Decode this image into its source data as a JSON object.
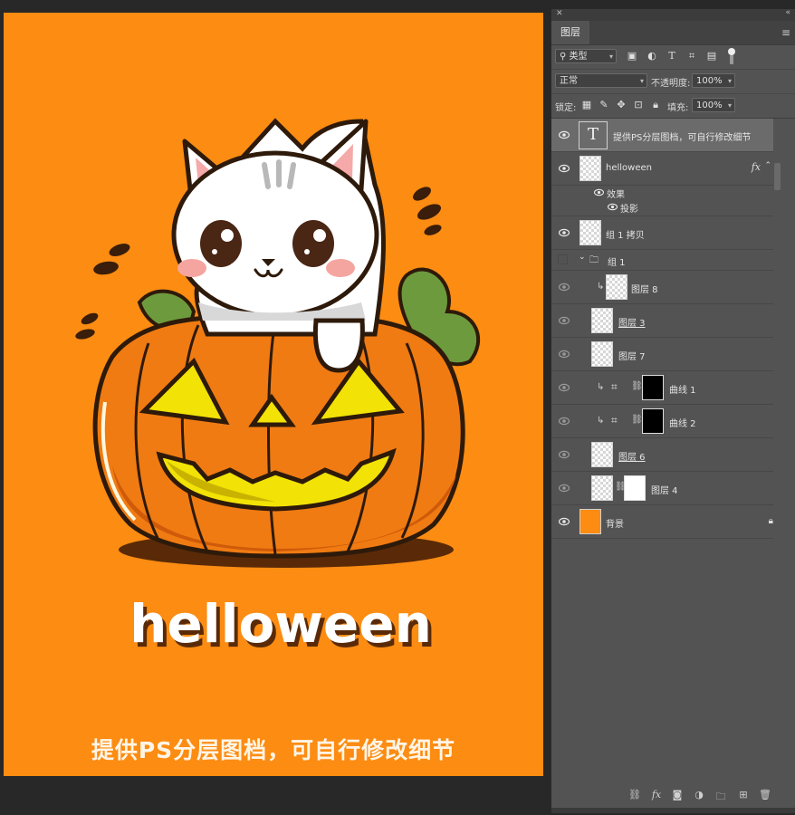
{
  "canvas": {
    "background_color": "#fc8c12",
    "headline": "helloween",
    "caption": "提供PS分层图档，可自行修改细节"
  },
  "panel": {
    "tab_label": "图层",
    "filter": {
      "kind_value": "类型"
    },
    "blend_mode": "正常",
    "opacity_label": "不透明度:",
    "opacity_value": "100%",
    "lock_label": "锁定:",
    "fill_label": "填充:",
    "fill_value": "100%",
    "layers": {
      "text_layer": "提供PS分层图档，可自行修改细节",
      "helloween": "helloween",
      "effects_label": "效果",
      "drop_shadow_label": "投影",
      "group1_copy": "组 1 拷贝",
      "group1": "组 1",
      "layer8": "图层 8",
      "layer3": "图层 3",
      "layer7": "图层 7",
      "curves1": "曲线 1",
      "curves2": "曲线 2",
      "layer6": "图层 6",
      "layer4": "图层 4",
      "background": "背景"
    },
    "fx_symbol": "fx"
  }
}
